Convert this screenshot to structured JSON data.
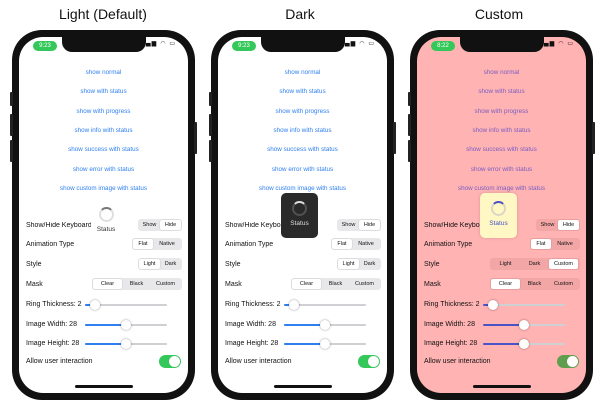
{
  "captions": [
    "Light (Default)",
    "Dark",
    "Custom"
  ],
  "times": [
    "9:23",
    "9:23",
    "8:22"
  ],
  "status_icons": "▂▄▆ ◠ ▭",
  "actions": [
    "show normal",
    "show with status",
    "show with progress",
    "show info with status",
    "show success with status",
    "show error with status",
    "show custom image with status"
  ],
  "labels": {
    "show_hide": [
      "Show/Hide Keyboard",
      "Show/Hide Keyboard",
      "Show/Hide Keyboard"
    ],
    "animation": "Animation Type",
    "style": "Style",
    "mask": "Mask",
    "ring": "Ring Thickness: 2",
    "img_width": "Image Width: 28",
    "img_height": "Image Height: 28",
    "allow": "Allow user interaction"
  },
  "segments": {
    "show_hide": [
      "Show",
      "Hide"
    ],
    "animation": [
      "Flat",
      "Native"
    ],
    "style_two": [
      "Light",
      "Dark"
    ],
    "style_three": [
      "Light",
      "Dark",
      "Custom"
    ],
    "mask": [
      "Clear",
      "Black",
      "Custom"
    ]
  },
  "hud_status": "Status",
  "sliders": {
    "ring": 0.12,
    "img_width": 0.5,
    "img_height": 0.5
  },
  "allow_user_interaction": true,
  "colors": {
    "light_bg": "#ffffff",
    "dark_bg": "#ffffff",
    "custom_bg": "#ffb3b3",
    "link": "#2f7ff0",
    "custom_link": "#7a5cc0",
    "toggle_on": "#34c759",
    "dark_hud": "#2a2a2a",
    "custom_hud": "#fff8c4"
  }
}
